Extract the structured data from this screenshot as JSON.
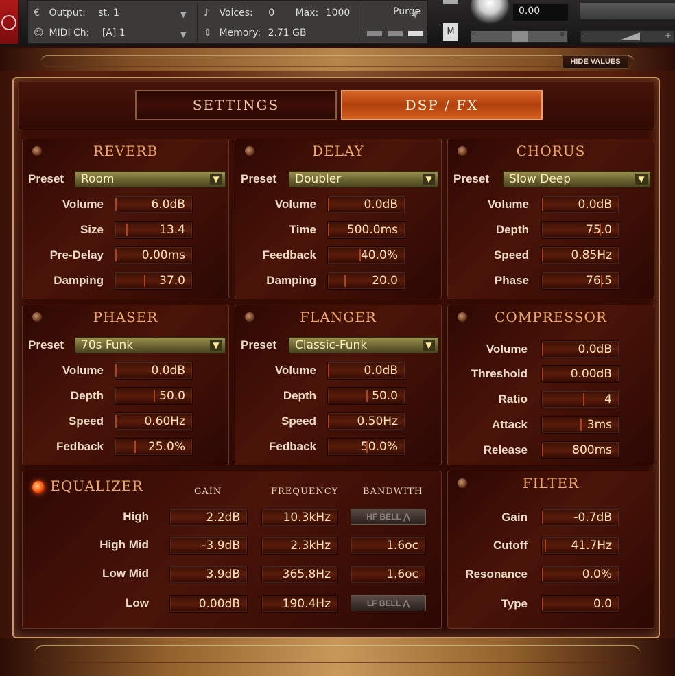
{
  "header": {
    "output_label": "Output:",
    "output_value": "st. 1",
    "midi_label": "MIDI Ch:",
    "midi_value": "[A]  1",
    "voices_label": "Voices:",
    "voices_value": "0",
    "max_label": "Max:",
    "max_value": "1000",
    "memory_label": "Memory:",
    "memory_value": "2.71 GB",
    "purge_label": "Purge",
    "mute_label": "M",
    "tune_value": "0.00",
    "pan_left": "L",
    "pan_right": "R",
    "vol_minus": "-",
    "vol_plus": "+"
  },
  "hide_values_label": "HIDE VALUES",
  "tabs": {
    "settings": "SETTINGS",
    "dsp": "DSP / FX",
    "active": "dsp"
  },
  "preset_label": "Preset",
  "reverb": {
    "title": "REVERB",
    "preset": "Room",
    "rows": [
      {
        "label": "Volume",
        "value": "6.0dB"
      },
      {
        "label": "Size",
        "value": "13.4"
      },
      {
        "label": "Pre-Delay",
        "value": "0.00ms"
      },
      {
        "label": "Damping",
        "value": "37.0"
      }
    ]
  },
  "delay": {
    "title": "DELAY",
    "preset": "Doubler",
    "rows": [
      {
        "label": "Volume",
        "value": "0.0dB"
      },
      {
        "label": "Time",
        "value": "500.0ms"
      },
      {
        "label": "Feedback",
        "value": "40.0%"
      },
      {
        "label": "Damping",
        "value": "20.0"
      }
    ]
  },
  "chorus": {
    "title": "CHORUS",
    "preset": "Slow Deep",
    "rows": [
      {
        "label": "Volume",
        "value": "0.0dB"
      },
      {
        "label": "Depth",
        "value": "75.0"
      },
      {
        "label": "Speed",
        "value": "0.85Hz"
      },
      {
        "label": "Phase",
        "value": "76.5"
      }
    ]
  },
  "phaser": {
    "title": "PHASER",
    "preset": "70s Funk",
    "rows": [
      {
        "label": "Volume",
        "value": "0.0dB"
      },
      {
        "label": "Depth",
        "value": "50.0"
      },
      {
        "label": "Speed",
        "value": "0.60Hz"
      },
      {
        "label": "Fedback",
        "value": "25.0%"
      }
    ]
  },
  "flanger": {
    "title": "FLANGER",
    "preset": "Classic-Funk",
    "rows": [
      {
        "label": "Volume",
        "value": "0.0dB"
      },
      {
        "label": "Depth",
        "value": "50.0"
      },
      {
        "label": "Speed",
        "value": "0.50Hz"
      },
      {
        "label": "Fedback",
        "value": "50.0%"
      }
    ]
  },
  "compressor": {
    "title": "COMPRESSOR",
    "rows": [
      {
        "label": "Volume",
        "value": "0.0dB"
      },
      {
        "label": "Threshold",
        "value": "0.00dB"
      },
      {
        "label": "Ratio",
        "value": "4"
      },
      {
        "label": "Attack",
        "value": "3ms"
      },
      {
        "label": "Release",
        "value": "800ms"
      }
    ]
  },
  "equalizer": {
    "title": "EQUALIZER",
    "headers": {
      "gain": "GAIN",
      "frequency": "FREQUENCY",
      "bandwidth": "BANDWITH"
    },
    "bands": [
      {
        "label": "High",
        "gain": "2.2dB",
        "freq": "10.3kHz",
        "bw": "HF BELL ⋀"
      },
      {
        "label": "High Mid",
        "gain": "-3.9dB",
        "freq": "2.3kHz",
        "bw": "1.6oc"
      },
      {
        "label": "Low Mid",
        "gain": "3.9dB",
        "freq": "365.8Hz",
        "bw": "1.6oc"
      },
      {
        "label": "Low",
        "gain": "0.00dB",
        "freq": "190.4Hz",
        "bw": "LF BELL ⋀"
      }
    ]
  },
  "filter": {
    "title": "FILTER",
    "rows": [
      {
        "label": "Gain",
        "value": "-0.7dB"
      },
      {
        "label": "Cutoff",
        "value": "41.7Hz"
      },
      {
        "label": "Resonance",
        "value": "0.0%"
      },
      {
        "label": "Type",
        "value": "0.0"
      }
    ]
  }
}
